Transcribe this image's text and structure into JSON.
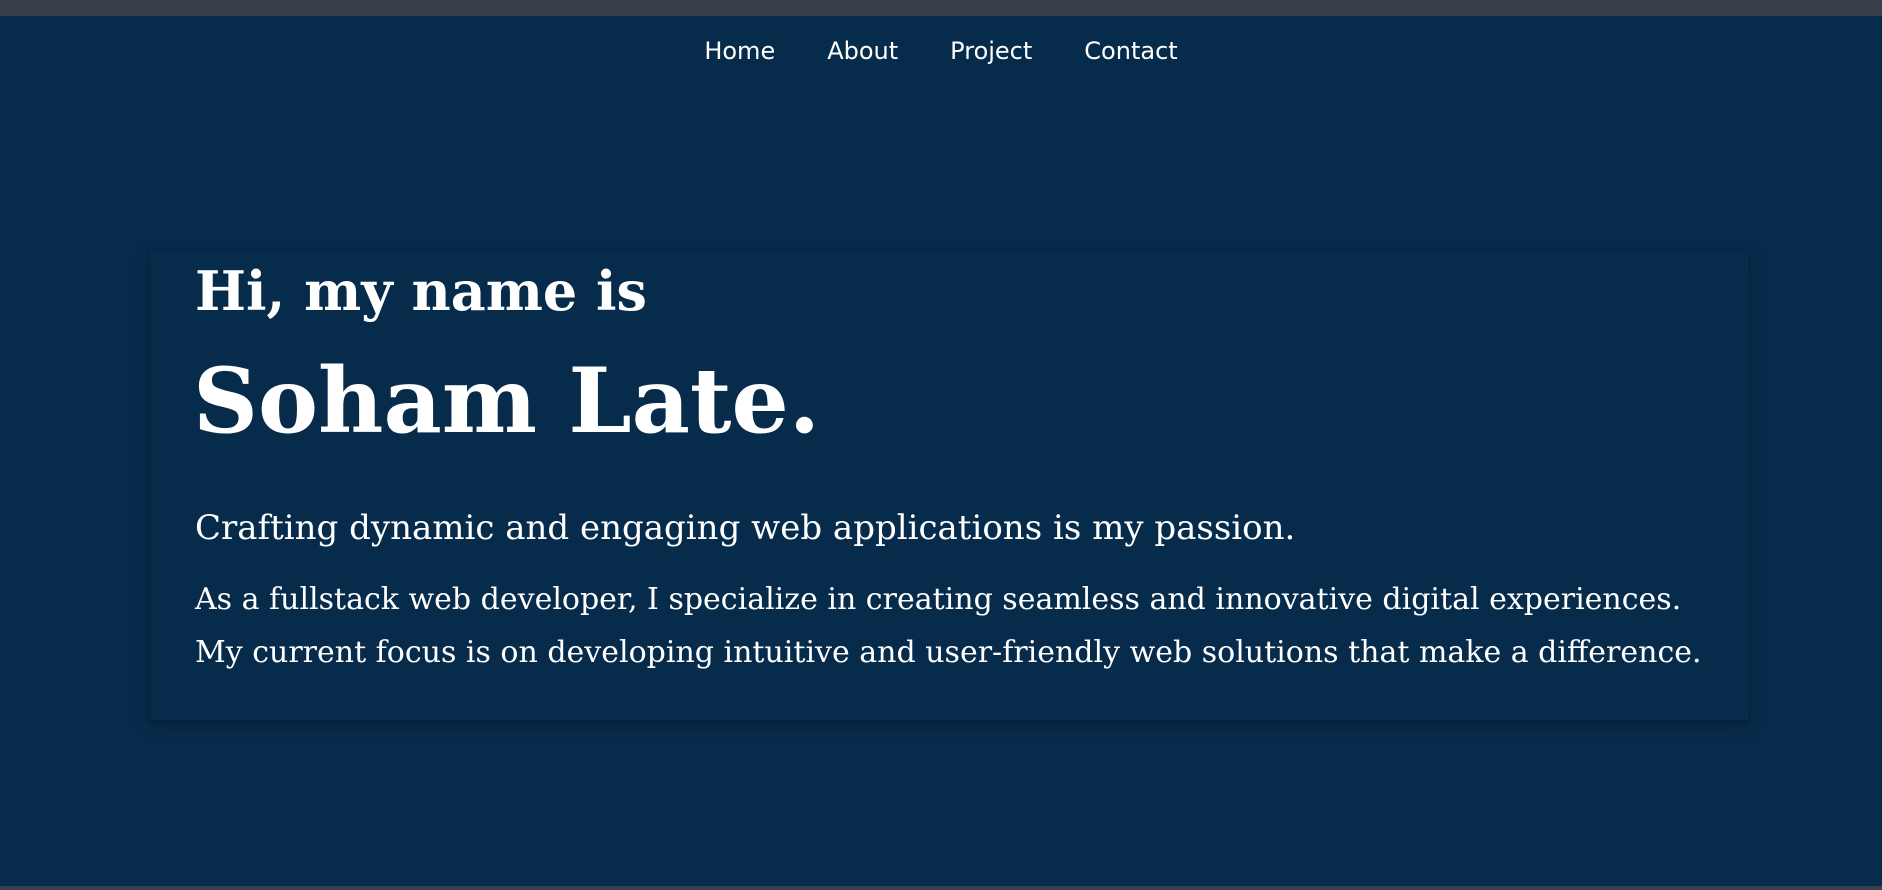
{
  "nav": {
    "items": [
      {
        "label": "Home"
      },
      {
        "label": "About"
      },
      {
        "label": "Project"
      },
      {
        "label": "Contact"
      }
    ]
  },
  "hero": {
    "greeting": "Hi, my name is",
    "name": "Soham Late.",
    "tagline": "Crafting dynamic and engaging web applications is my passion.",
    "bio": "As a fullstack web developer, I specialize in creating seamless and innovative digital experiences. My current focus is on developing intuitive and user-friendly web solutions that make a difference."
  },
  "colors": {
    "background": "#072c4b",
    "text": "#ffffff",
    "browser_chrome": "#3a3f4c"
  }
}
